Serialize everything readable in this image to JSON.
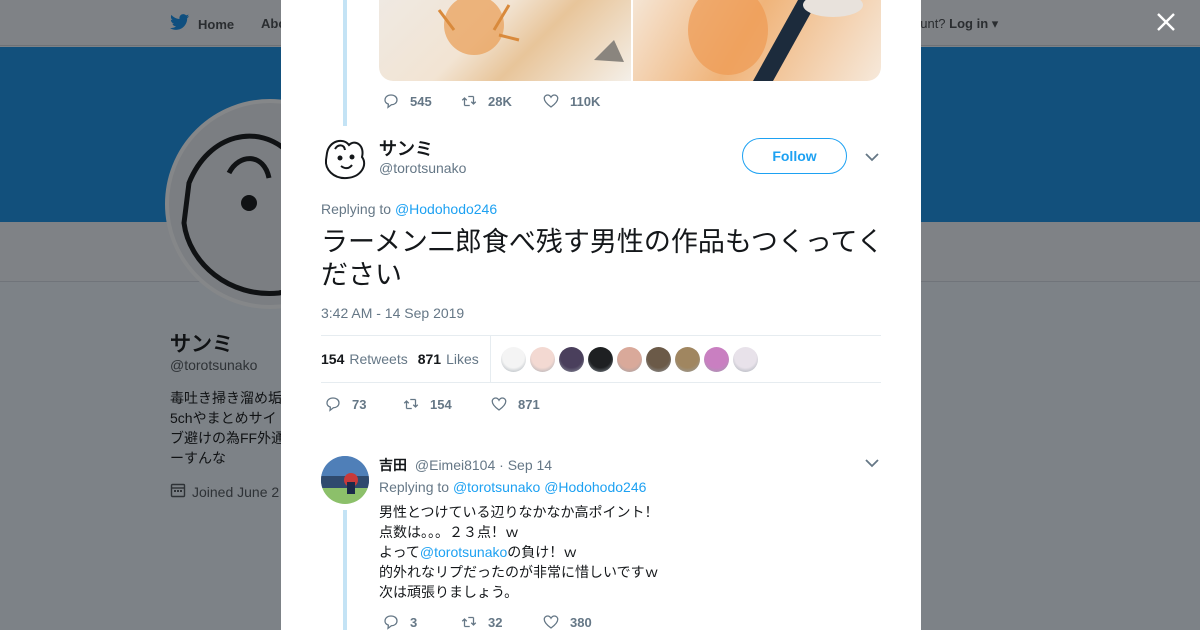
{
  "background": {
    "nav": {
      "home_label": "Home",
      "about_label": "Abo",
      "account_prompt": "ccount?",
      "login_label": "Log in"
    },
    "profile": {
      "name": "サンミ",
      "handle": "@torotsunako",
      "bio_lines": [
        "毒吐き掃き溜め垢",
        "5chやまとめサイ",
        "ブ避けの為FF外通",
        "ーすんな"
      ],
      "joined": "Joined June 2"
    }
  },
  "colors": {
    "accent": "#1da1f2",
    "banner": "#12507c",
    "thread_line": "#c4e3f5",
    "muted": "#657786"
  },
  "modal": {
    "prev_tweet": {
      "replies": "545",
      "retweets": "28K",
      "likes": "110K"
    },
    "main_tweet": {
      "name": "サンミ",
      "handle": "@torotsunako",
      "follow_label": "Follow",
      "replying_prefix": "Replying to",
      "replying_to": "@Hodohodo246",
      "text": "ラーメン二郎食べ残す男性の作品もつくってください",
      "timestamp": "3:42 AM - 14 Sep 2019",
      "retweet_count": "154",
      "retweet_label": "Retweets",
      "like_count": "871",
      "like_label": "Likes",
      "liker_avatar_colors": [
        "#f4f4f4",
        "#f3d9d2",
        "#4a3f5c",
        "#1e2022",
        "#d9a99a",
        "#6b5a48",
        "#a08660",
        "#c97fc1",
        "#e8e2ea"
      ],
      "actions": {
        "replies": "73",
        "retweets": "154",
        "likes": "871"
      }
    },
    "reply_tweet": {
      "name": "吉田",
      "handle": "@Eimei8104",
      "date": "Sep 14",
      "replying_prefix": "Replying to",
      "replying_to_1": "@torotsunako",
      "replying_to_2": "@Hodohodo246",
      "line1": "男性とつけている辺りなかなか高ポイント！",
      "line2": "点数は。。。２３点！ｗ",
      "line3_prefix": "よって",
      "line3_mention": "@torotsunako",
      "line3_suffix": "の負け！ｗ",
      "line4": "的外れなリプだったのが非常に惜しいですｗ",
      "line5": "次は頑張りましょう。",
      "actions": {
        "replies": "3",
        "retweets": "32",
        "likes": "380"
      }
    }
  }
}
